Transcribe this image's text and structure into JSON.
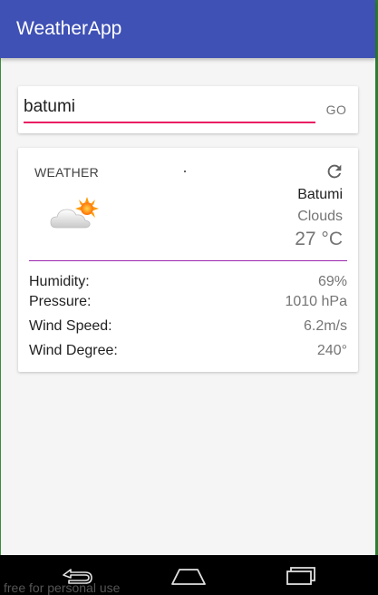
{
  "app": {
    "title": "WeatherApp"
  },
  "search": {
    "value": "batumi",
    "go_label": "GO"
  },
  "weather": {
    "section_label": "WEATHER",
    "icon": "cloud-sun-icon",
    "city": "Batumi",
    "condition": "Clouds",
    "temperature": "27 °C",
    "details": [
      {
        "label": "Humidity:",
        "value": "69%"
      },
      {
        "label": "Pressure:",
        "value": "1010 hPa"
      },
      {
        "label": "Wind Speed:",
        "value": "6.2m/s"
      },
      {
        "label": "Wind Degree:",
        "value": "240°"
      }
    ]
  },
  "navbar": {
    "icons": [
      "back-icon",
      "home-icon",
      "recents-icon"
    ]
  },
  "watermark": "free for personal use",
  "colors": {
    "app_bar": "#3f51b5",
    "accent_underline": "#e91e63",
    "divider": "#9c27b0",
    "sun": "#ff9800"
  }
}
